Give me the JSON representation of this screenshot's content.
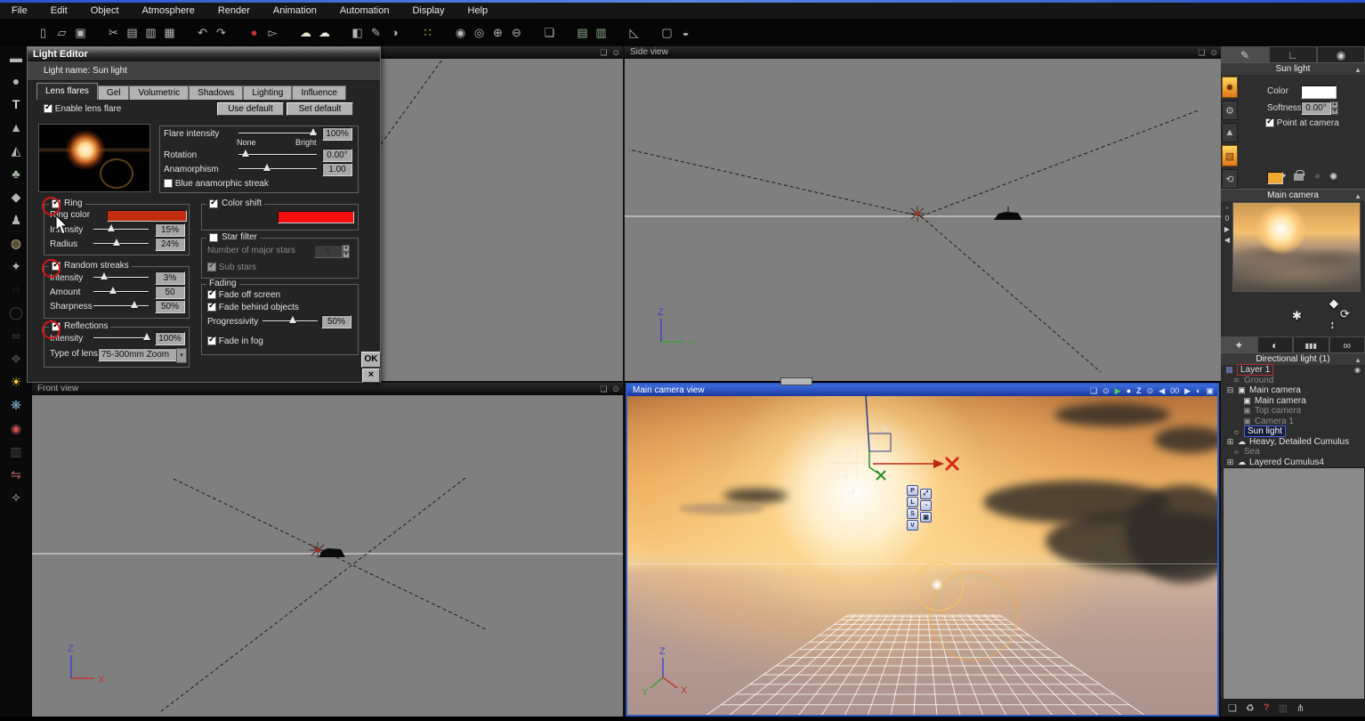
{
  "window": {
    "menu_items": [
      "File",
      "Edit",
      "Object",
      "Atmosphere",
      "Render",
      "Animation",
      "Automation",
      "Display",
      "Help"
    ]
  },
  "light_editor": {
    "title": "Light Editor",
    "name_row": "Light name: Sun light",
    "tabs": [
      "Lens flares",
      "Gel",
      "Volumetric",
      "Shadows",
      "Lighting",
      "Influence"
    ],
    "enable": "Enable lens flare",
    "use_default": "Use default",
    "set_default": "Set default",
    "flare_intensity_label": "Flare intensity",
    "flare_intensity_value": "100%",
    "none_label": "None",
    "bright_label": "Bright",
    "rotation_label": "Rotation",
    "rotation_value": "0.00°",
    "anamorphism_label": "Anamorphism",
    "anamorphism_value": "1.00",
    "blue_streak_label": "Blue anamorphic streak",
    "ring_label": "Ring",
    "ring_color_label": "Ring color",
    "ring_intensity_label": "Intensity",
    "ring_intensity_value": "15%",
    "ring_radius_label": "Radius",
    "ring_radius_value": "24%",
    "color_shift_label": "Color shift",
    "star_filter_label": "Star filter",
    "major_stars_label": "Number of major stars",
    "major_stars_value": "6",
    "sub_stars_label": "Sub stars",
    "streaks_label": "Random streaks",
    "streaks_intensity_label": "Intensity",
    "streaks_intensity_value": "3%",
    "streaks_amount_label": "Amount",
    "streaks_amount_value": "50",
    "streaks_sharpness_label": "Sharpness",
    "streaks_sharpness_value": "50%",
    "fading_label": "Fading",
    "fade_off_label": "Fade off screen",
    "fade_behind_label": "Fade behind objects",
    "progressivity_label": "Progressivity",
    "progressivity_value": "50%",
    "fade_fog_label": "Fade in fog",
    "reflections_label": "Reflections",
    "refl_intensity_label": "Intensity",
    "refl_intensity_value": "100%",
    "lens_label": "Type of lens",
    "lens_value": "75-300mm Zoom",
    "ok_label": "OK",
    "close_label": "×"
  },
  "viewports": {
    "side": {
      "title": "Side view"
    },
    "front": {
      "title": "Front view"
    },
    "main": {
      "title": "Main camera view",
      "frame_counter": "00",
      "z_buffer_label": "Z"
    }
  },
  "axes": {
    "z": "Z",
    "y": "Y",
    "x": "X"
  },
  "gizmo": {
    "buttons": [
      "P",
      "L",
      "S",
      "V"
    ]
  },
  "right_panel": {
    "sun": {
      "title": "Sun light",
      "color_label": "Color",
      "softness_label": "Softness",
      "softness_value": "0.00°",
      "point_label": "Point at camera"
    },
    "camera_title": "Main camera",
    "browser_title": "Directional light (1)",
    "tree": [
      "Layer 1",
      "Ground",
      "Main camera",
      "Main camera",
      "Top camera",
      "Camera 1",
      "Sun light",
      "Heavy, Detailed Cumulus",
      "Sea",
      "Layered Cumulus4"
    ]
  },
  "colors": {
    "selection_blue": "#2e5bc0",
    "annotation_red": "#d81616",
    "ring_swatch_red": "#c22d12",
    "color_shift_red": "#f51010",
    "sun_color_swatch": "#ffffff",
    "orange_swatch": "#f0a830"
  },
  "glyphs": {
    "file_new": "▯",
    "file_open": "▱",
    "file_save": "▣",
    "cut": "✂",
    "copy": "▤",
    "paste": "▥",
    "paste_special": "▦",
    "undo": "↶",
    "redo": "↷",
    "select": "●",
    "pointer": "▻",
    "cloud_a": "☁",
    "cloud_b": "☁",
    "cube": "◧",
    "paint": "✎",
    "render_area": "◑",
    "palette": "∷",
    "sphere_a": "◉",
    "sphere_b": "◎",
    "zoom_in": "⊕",
    "zoom_out": "⊖",
    "screen": "❏",
    "film_a": "▤",
    "film_b": "▥",
    "clapper": "◺",
    "crop": "▢",
    "render_final": "◒",
    "tool_ground": "▬",
    "tool_sphere": "●",
    "tool_text": "T",
    "tool_terrain": "▲",
    "tool_terrain2": "◭",
    "tool_plant": "♣",
    "tool_rock": "◆",
    "tool_figure": "♟",
    "tool_planet": "◍",
    "tool_object": "✦",
    "tool_meta": "◌",
    "tool_blob": "◯",
    "tool_mix": "∞",
    "tool_bool": "❖",
    "tool_light": "☀",
    "tool_wind": "❋",
    "tool_material": "◉",
    "tool_chart": "▥",
    "tool_flip": "⇋",
    "tool_wand": "✧",
    "win": "❏",
    "zoomwin": "⊙",
    "play": "▶",
    "rec": "●",
    "mag": "⊙",
    "arrow_l": "◀",
    "arrow_r": "▶",
    "half": "◐",
    "save_small": "▣",
    "brush": "✎",
    "ruler": "∟",
    "camera_tab": "◉",
    "light_big": "✹",
    "gear": "⚙",
    "cone": "▲",
    "cube_orange": "▧",
    "refresh": "⟲",
    "dropdown": "▾",
    "sparkle_a": "✷",
    "sparkle_b": "✺",
    "hand": "✱",
    "gem": "◆",
    "updown": "↕",
    "rotate": "⟳",
    "tab_objects": "✦",
    "tab_material": "◐",
    "tab_sliders": "▮▮▮",
    "tab_links": "∞",
    "eye": "◉",
    "tr_layer": "▦",
    "tr_ground": "≋",
    "tr_camera": "▣",
    "tr_light": "☼",
    "tr_cloud": "☁",
    "tr_sea": "≈",
    "plus": "⊞",
    "minus": "⊟",
    "collapse": "▲",
    "new_layer": "❏",
    "trash": "♻",
    "layer_q": "?",
    "hierarchy": "⋔",
    "preview_sq": "▪",
    "preview_zero": "0"
  }
}
